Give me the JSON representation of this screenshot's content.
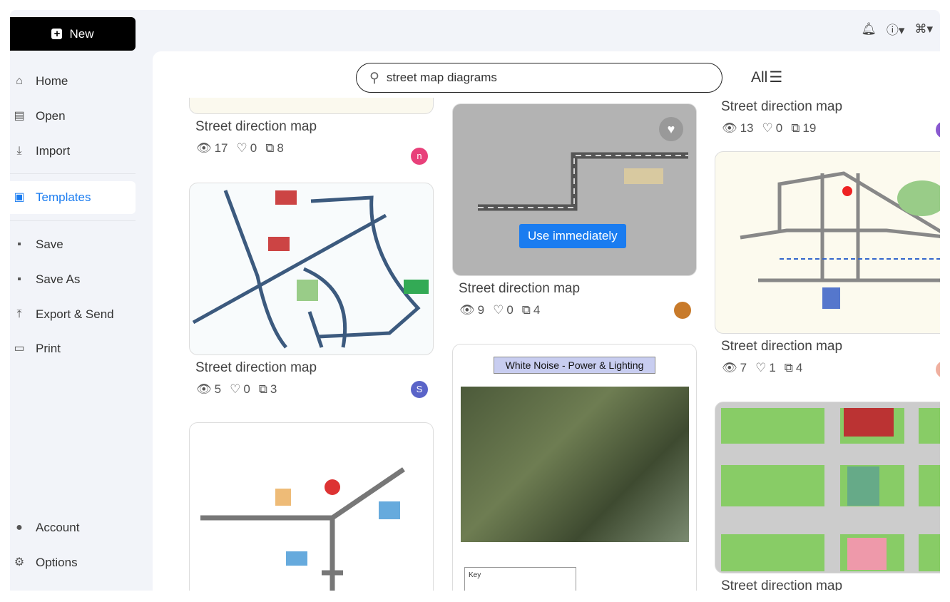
{
  "sidebar": {
    "new_label": "New",
    "items": [
      {
        "label": "Home",
        "icon": "home-icon",
        "glyph": "⌂"
      },
      {
        "label": "Open",
        "icon": "file-icon",
        "glyph": "▤"
      },
      {
        "label": "Import",
        "icon": "import-icon",
        "glyph": "⤓"
      },
      {
        "label": "Templates",
        "icon": "templates-icon",
        "glyph": "▣"
      },
      {
        "label": "Save",
        "icon": "save-icon",
        "glyph": "▪"
      },
      {
        "label": "Save As",
        "icon": "save-as-icon",
        "glyph": "▪"
      },
      {
        "label": "Export & Send",
        "icon": "export-icon",
        "glyph": "⤒"
      },
      {
        "label": "Print",
        "icon": "print-icon",
        "glyph": "▭"
      },
      {
        "label": "Account",
        "icon": "account-icon",
        "glyph": "●"
      },
      {
        "label": "Options",
        "icon": "gear-icon",
        "glyph": "⚙"
      }
    ],
    "active": "Templates"
  },
  "search": {
    "value": "street map diagrams",
    "filter_label": "All"
  },
  "accent": "#1a7cf0",
  "cards": [
    {
      "title": "Street direction map",
      "views": "17",
      "likes": "0",
      "copies": "8",
      "avatar": "n",
      "avatar_color": "#e8407a"
    },
    {
      "title": "Street direction map",
      "views": "5",
      "likes": "0",
      "copies": "3",
      "avatar": "S",
      "avatar_color": "#5a64c8"
    },
    {
      "title": "Street direction map",
      "views": "9",
      "likes": "0",
      "copies": "4",
      "avatar": "",
      "avatar_color": "#c87a2a",
      "hover_button": "Use immediately"
    },
    {
      "title": "White Noise - Power & Lighting",
      "key_label": "Key"
    },
    {
      "title": "Street direction map",
      "views": "13",
      "likes": "0",
      "copies": "19",
      "avatar": "",
      "avatar_color": "#8a5ad0"
    },
    {
      "title": "Street direction map",
      "views": "7",
      "likes": "1",
      "copies": "4",
      "avatar": "",
      "avatar_color": "#f0b0a0"
    },
    {
      "title": "Street direction map"
    }
  ]
}
